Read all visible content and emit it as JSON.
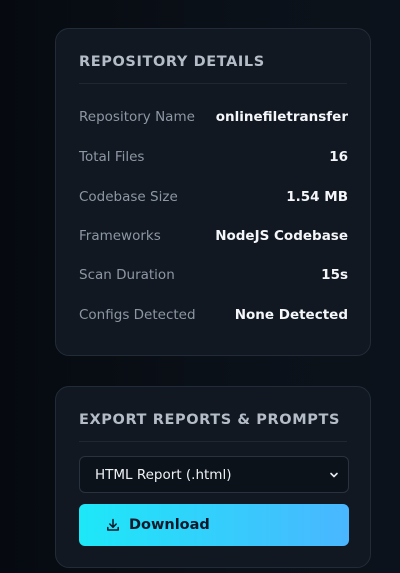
{
  "repository_details": {
    "title": "REPOSITORY DETAILS",
    "rows": [
      {
        "label": "Repository Name",
        "value": "onlinefiletransfer"
      },
      {
        "label": "Total Files",
        "value": "16"
      },
      {
        "label": "Codebase Size",
        "value": "1.54 MB"
      },
      {
        "label": "Frameworks",
        "value": "NodeJS Codebase"
      },
      {
        "label": "Scan Duration",
        "value": "15s"
      },
      {
        "label": "Configs Detected",
        "value": "None Detected"
      }
    ]
  },
  "export": {
    "title": "EXPORT REPORTS & PROMPTS",
    "format_select": {
      "selected": "HTML Report (.html)"
    },
    "download_label": "Download",
    "download_icon": "download-icon",
    "select_icon": "chevron-down-icon"
  },
  "colors": {
    "background": "#090d14",
    "card": "#111821",
    "accent_start": "#1de8f8",
    "accent_end": "#4ab6ff"
  }
}
